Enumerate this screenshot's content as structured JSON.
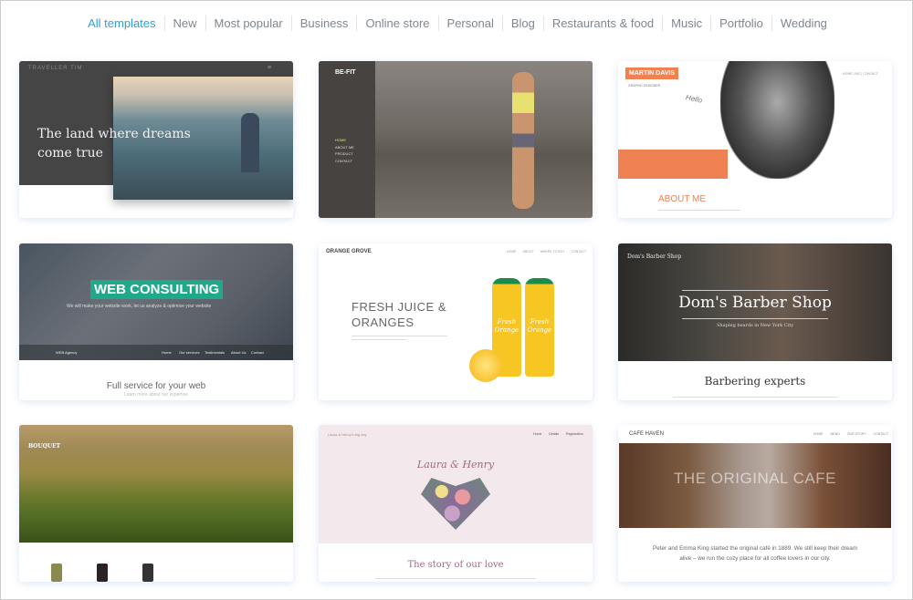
{
  "tabs": [
    {
      "label": "All templates",
      "active": true
    },
    {
      "label": "New"
    },
    {
      "label": "Most popular"
    },
    {
      "label": "Business"
    },
    {
      "label": "Online store"
    },
    {
      "label": "Personal"
    },
    {
      "label": "Blog"
    },
    {
      "label": "Restaurants & food"
    },
    {
      "label": "Music"
    },
    {
      "label": "Portfolio"
    },
    {
      "label": "Wedding"
    }
  ],
  "colors": {
    "accent": "#2d9fd9",
    "tab_text": "#7d8791",
    "orange": "#ef8153",
    "teal": "#1fa98a"
  },
  "templates": {
    "traveller": {
      "brand": "TRAVELLER TIM",
      "headline": "The land where dreams come true"
    },
    "befit": {
      "brand": "BE-FIT",
      "nav": [
        "HOME",
        "ABOUT ME",
        "PRODUCT",
        "CONTACT"
      ]
    },
    "martin": {
      "brand": "MARTIN DAVIS",
      "subtitle": "GRAPHIC DESIGNER",
      "nav": "HOME | BIO | CONTACT",
      "hello": "Hello",
      "heading": "ABOUT ME"
    },
    "consulting": {
      "headline": "WEB CONSULTING",
      "tagline": "We will make your website work, let us analyze & optimize your website",
      "brand": "WEB Agency",
      "nav": [
        "Home",
        "Our services",
        "Testimonials",
        "About Us",
        "Contact"
      ],
      "heading": "Full service for your web",
      "sub": "Learn more about our expertise"
    },
    "orange": {
      "brand": "ORANGE GROVE",
      "nav": [
        "HOME",
        "ABOUT",
        "WHERE TO BUY",
        "CONTACT"
      ],
      "headline": "FRESH JUICE & ORANGES",
      "bottle_label": "Fresh Orange"
    },
    "barber": {
      "brand": "Dom's Barber Shop",
      "headline": "Dom's Barber Shop",
      "tagline": "Shaping beards in New York City",
      "heading": "Barbering experts"
    },
    "bouquet": {
      "brand": "BOUQUET"
    },
    "wedding": {
      "brand": "Laura & Henry's big day",
      "nav": [
        "Home",
        "Details",
        "Registration"
      ],
      "names": "Laura & Henry",
      "heading": "The story of our love"
    },
    "cafe": {
      "brand": "CAFE HAVEN",
      "nav": [
        "HOME",
        "MENU",
        "OUR STORY",
        "CONTACT"
      ],
      "headline": "THE ORIGINAL CAFE",
      "body": "Peter and Emma King started the original café in 1889. We still keep their dream alive – we run the cozy place for all coffee lovers in our city."
    }
  }
}
